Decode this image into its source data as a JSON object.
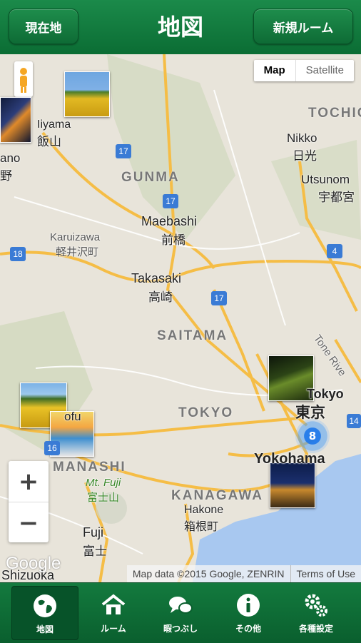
{
  "header": {
    "left_button": "現在地",
    "title": "地図",
    "right_button": "新規ルーム"
  },
  "map_type": {
    "map": "Map",
    "satellite": "Satellite"
  },
  "places": {
    "iiyama_en": "Iiyama",
    "iiyama_jp": "飯山",
    "nikko_en": "Nikko",
    "nikko_jp": "日光",
    "utsunomiya_en": "Utsunom",
    "utsunomiya_jp": "宇都宮",
    "tochigi": "TOCHIG",
    "gunma": "GUNMA",
    "maebashi_en": "Maebashi",
    "maebashi_jp": "前橋",
    "karuizawa_en": "Karuizawa",
    "karuizawa_jp": "軽井沢町",
    "takasaki_en": "Takasaki",
    "takasaki_jp": "高崎",
    "saitama": "SAITAMA",
    "tokyo_region": "TOKYO",
    "tokyo_en": "Tokyo",
    "tokyo_jp": "東京",
    "yokohama": "Yokohama",
    "kanagawa": "KANAGAWA",
    "yamanashi": "MANASHI",
    "fuji_mt_en": "Mt. Fuji",
    "fuji_mt_jp": "富士山",
    "hakone_en": "Hakone",
    "hakone_jp": "箱根町",
    "fuji_en": "Fuji",
    "fuji_jp": "富士",
    "shizuoka": "Shizuoka",
    "nagano_en": "ano",
    "nagano_jp": "野",
    "kofu": "ofu",
    "tone": "Tone Rive"
  },
  "routes": {
    "r17a": "17",
    "r17b": "17",
    "r17c": "17",
    "r18": "18",
    "r4": "4",
    "r14": "14",
    "r16": "16"
  },
  "cluster_count": "8",
  "zoom": {
    "plus": "+",
    "minus": "−"
  },
  "attribution": {
    "data": "Map data ©2015 Google, ZENRIN",
    "terms": "Terms of Use"
  },
  "google_logo": "Google",
  "tabs": [
    {
      "label": "地図",
      "icon": "globe-icon"
    },
    {
      "label": "ルーム",
      "icon": "house-icon"
    },
    {
      "label": "暇つぶし",
      "icon": "chat-icon"
    },
    {
      "label": "その他",
      "icon": "info-icon"
    },
    {
      "label": "各種設定",
      "icon": "gears-icon"
    }
  ]
}
